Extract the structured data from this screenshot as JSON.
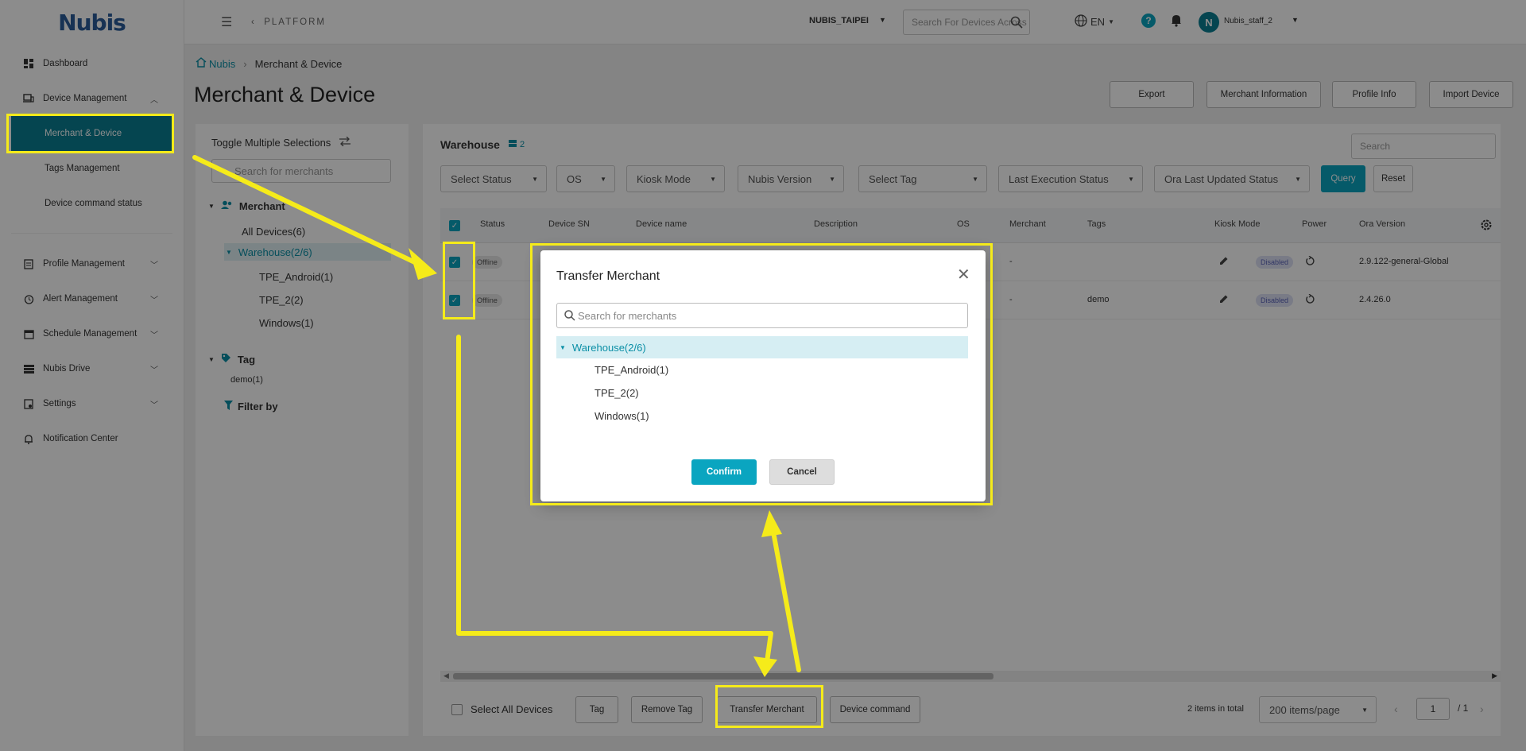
{
  "app": {
    "logo": "Nubis"
  },
  "sidebar": {
    "items": [
      {
        "label": "Dashboard"
      },
      {
        "label": "Device Management"
      },
      {
        "label": "Merchant & Device"
      },
      {
        "label": "Tags Management"
      },
      {
        "label": "Device command status"
      },
      {
        "label": "Profile Management"
      },
      {
        "label": "Alert Management"
      },
      {
        "label": "Schedule Management"
      },
      {
        "label": "Nubis Drive"
      },
      {
        "label": "Settings"
      },
      {
        "label": "Notification Center"
      }
    ]
  },
  "topbar": {
    "section": "PLATFORM",
    "tenant": "NUBIS_TAIPEI",
    "search_placeholder": "Search For Devices Across",
    "language": "EN",
    "help": "?",
    "avatar_initial": "N",
    "user": "Nubis_staff_2"
  },
  "breadcrumb": {
    "home": "Nubis",
    "current": "Merchant & Device"
  },
  "page": {
    "title": "Merchant & Device"
  },
  "header_buttons": {
    "export": "Export",
    "merchant_info": "Merchant Information",
    "profile_info": "Profile Info",
    "import_device": "Import Device"
  },
  "left_panel": {
    "toggle": "Toggle Multiple Selections",
    "search_placeholder": "Search for merchants",
    "merchant_heading": "Merchant",
    "all_devices": "All Devices(6)",
    "warehouse": "Warehouse(2/6)",
    "children": [
      "TPE_Android(1)",
      "TPE_2(2)",
      "Windows(1)"
    ],
    "tag_heading": "Tag",
    "tag_item": "demo(1)",
    "filter_by": "Filter by"
  },
  "table_panel": {
    "title": "Warehouse",
    "count": "2",
    "search_placeholder": "Search",
    "filters": [
      "Select Status",
      "OS",
      "Kiosk Mode",
      "Nubis Version",
      "Select Tag",
      "Last Execution Status",
      "Ora Last Updated Status"
    ],
    "query": "Query",
    "reset": "Reset",
    "columns": [
      "Status",
      "Device SN",
      "Device name",
      "Description",
      "OS",
      "Merchant",
      "Tags",
      "Kiosk Mode",
      "Power",
      "Ora Version"
    ],
    "rows": [
      {
        "status": "Offline",
        "merchant": "-",
        "tags": "",
        "kiosk": "Disabled",
        "ora": "2.9.122-general-Global"
      },
      {
        "status": "Offline",
        "merchant": "-",
        "tags": "demo",
        "kiosk": "Disabled",
        "ora": "2.4.26.0"
      }
    ]
  },
  "bottom_bar": {
    "select_all": "Select All Devices",
    "tag": "Tag",
    "remove_tag": "Remove Tag",
    "transfer_merchant": "Transfer Merchant",
    "device_command": "Device command",
    "total": "2 items in total",
    "page_size": "200 items/page",
    "page": "1",
    "page_total": "/ 1"
  },
  "modal": {
    "title": "Transfer Merchant",
    "search_placeholder": "Search for merchants",
    "root": "Warehouse(2/6)",
    "children": [
      "TPE_Android(1)",
      "TPE_2(2)",
      "Windows(1)"
    ],
    "confirm": "Confirm",
    "cancel": "Cancel"
  },
  "colors": {
    "accent": "#0aa5c0",
    "active_nav": "#0a7f93",
    "annotation": "#f5eb1a"
  }
}
